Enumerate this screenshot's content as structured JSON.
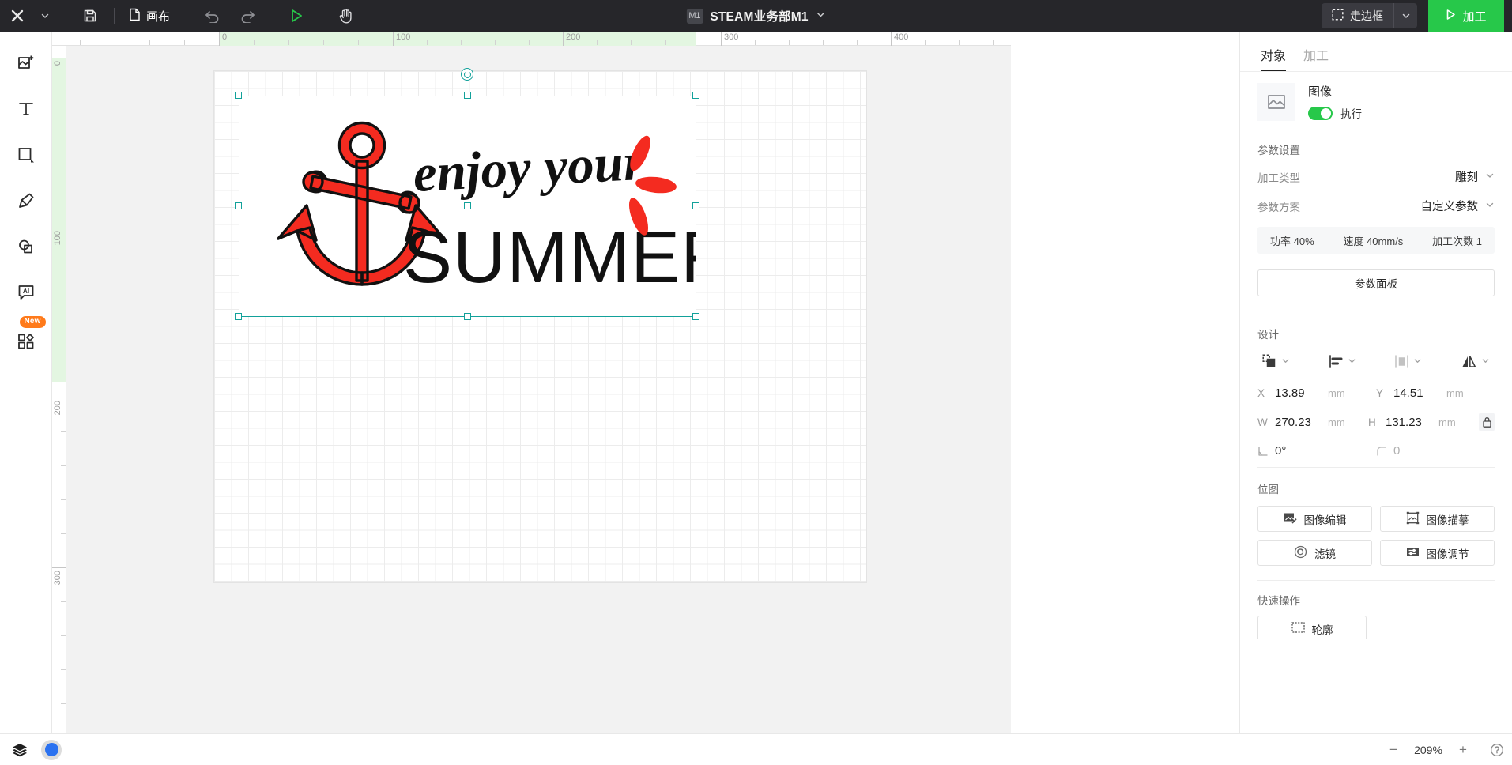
{
  "topbar": {
    "logo_icon": "x-logo-icon",
    "logo_caret_icon": "chevron-down-icon",
    "save_icon": "save-icon",
    "file_icon": "file-icon",
    "doc_label": "画布",
    "undo_icon": "undo-icon",
    "redo_icon": "redo-icon",
    "play_icon": "play-triangle-icon",
    "hand_icon": "hand-icon",
    "device_badge": "M1",
    "title": "STEAM业务部M1",
    "title_caret_icon": "chevron-down-icon",
    "frame_button_label": "走边框",
    "frame_button_icon": "frame-dashed-icon",
    "frame_caret_icon": "chevron-down-icon",
    "process_button_label": "加工",
    "process_button_icon": "play-triangle-icon",
    "process_color": "#27c84a"
  },
  "left_toolbar": {
    "items": [
      {
        "name": "add-image-icon",
        "badge": ""
      },
      {
        "name": "text-icon",
        "badge": ""
      },
      {
        "name": "shape-icon",
        "badge": ""
      },
      {
        "name": "pen-icon",
        "badge": ""
      },
      {
        "name": "boolean-shapes-icon",
        "badge": ""
      },
      {
        "name": "ai-icon",
        "badge": ""
      },
      {
        "name": "elements-icon",
        "badge": "New"
      }
    ],
    "new_badge_color": "#ff7a1a"
  },
  "canvas": {
    "ruler_h_labels": [
      "0",
      "100",
      "200",
      "300",
      "400"
    ],
    "ruler_v_labels": [
      "0",
      "100",
      "200",
      "300"
    ],
    "artwork": {
      "script_line": "enjoy your",
      "block_line": "SUMMER",
      "anchor_color": "#f42b20",
      "text_color": "#111111",
      "petal_color": "#f42b20"
    },
    "selection_color": "#12a19a"
  },
  "right_panel": {
    "tabs": [
      {
        "label": "对象",
        "active": true
      },
      {
        "label": "加工",
        "active": false
      }
    ],
    "object": {
      "thumb_icon": "image-icon",
      "title": "图像",
      "toggle_label": "执行",
      "toggle_on": true,
      "toggle_color": "#27c84a"
    },
    "params": {
      "section_title": "参数设置",
      "type_key": "加工类型",
      "type_value": "雕刻",
      "scheme_key": "参数方案",
      "scheme_value": "自定义参数",
      "strip": [
        "功率 40%",
        "速度 40mm/s",
        "加工次数 1"
      ],
      "panel_button": "参数面板"
    },
    "design": {
      "section_title": "设计",
      "icons": [
        "group-icon",
        "align-left-icon",
        "distribute-horizontal-icon",
        "mirror-icon"
      ],
      "x_key": "X",
      "x_value": "13.89",
      "x_unit": "mm",
      "y_key": "Y",
      "y_value": "14.51",
      "y_unit": "mm",
      "w_key": "W",
      "w_value": "270.23",
      "w_unit": "mm",
      "h_key": "H",
      "h_value": "131.23",
      "h_unit": "mm",
      "lock_icon": "link-lock-icon",
      "angle_icon": "angle-icon",
      "angle_value": "0°",
      "radius_icon": "corner-radius-icon",
      "radius_value": "0"
    },
    "bitmap": {
      "section_title": "位图",
      "buttons": [
        {
          "label": "图像编辑",
          "icon": "image-edit-icon"
        },
        {
          "label": "图像描摹",
          "icon": "image-trace-icon"
        },
        {
          "label": "滤镜",
          "icon": "filter-icon"
        },
        {
          "label": "图像调节",
          "icon": "image-adjust-icon"
        }
      ]
    },
    "quick": {
      "section_title": "快速操作",
      "first_button": "轮廓"
    }
  },
  "bottombar": {
    "layers_icon": "layers-icon",
    "swatch_icon": "color-swatch-icon",
    "swatch_color": "#2b72f0",
    "zoom_out_label": "−",
    "zoom_value": "209%",
    "zoom_in_label": "+",
    "help_icon": "help-circle-icon"
  }
}
